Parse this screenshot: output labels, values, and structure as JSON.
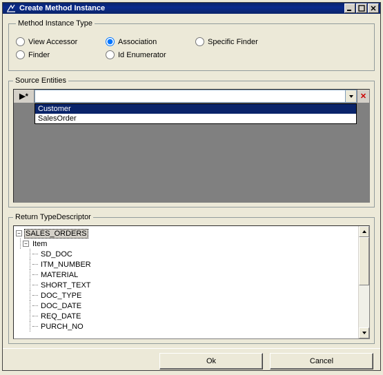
{
  "window": {
    "title": "Create Method Instance"
  },
  "methodInstanceType": {
    "legend": "Method Instance Type",
    "options": {
      "viewAccessor": "View Accessor",
      "association": "Association",
      "specificFinder": "Specific Finder",
      "finder": "Finder",
      "idEnumerator": "Id Enumerator"
    },
    "selected": "association"
  },
  "sourceEntities": {
    "legend": "Source Entities",
    "rowmarker": "▶*",
    "currentValue": "",
    "delete_glyph": "✕",
    "dropdown": {
      "open": true,
      "items": [
        "Customer",
        "SalesOrder"
      ],
      "highlighted": 0
    }
  },
  "returnTypeDescriptor": {
    "legend": "Return TypeDescriptor",
    "tree": {
      "root": {
        "label": "SALES_ORDERS",
        "expanded": true,
        "children": [
          {
            "label": "Item",
            "expanded": true,
            "children": [
              {
                "label": "SD_DOC"
              },
              {
                "label": "ITM_NUMBER"
              },
              {
                "label": "MATERIAL"
              },
              {
                "label": "SHORT_TEXT"
              },
              {
                "label": "DOC_TYPE"
              },
              {
                "label": "DOC_DATE"
              },
              {
                "label": "REQ_DATE"
              },
              {
                "label": "PURCH_NO"
              }
            ]
          }
        ]
      }
    }
  },
  "buttons": {
    "ok": "Ok",
    "cancel": "Cancel"
  }
}
